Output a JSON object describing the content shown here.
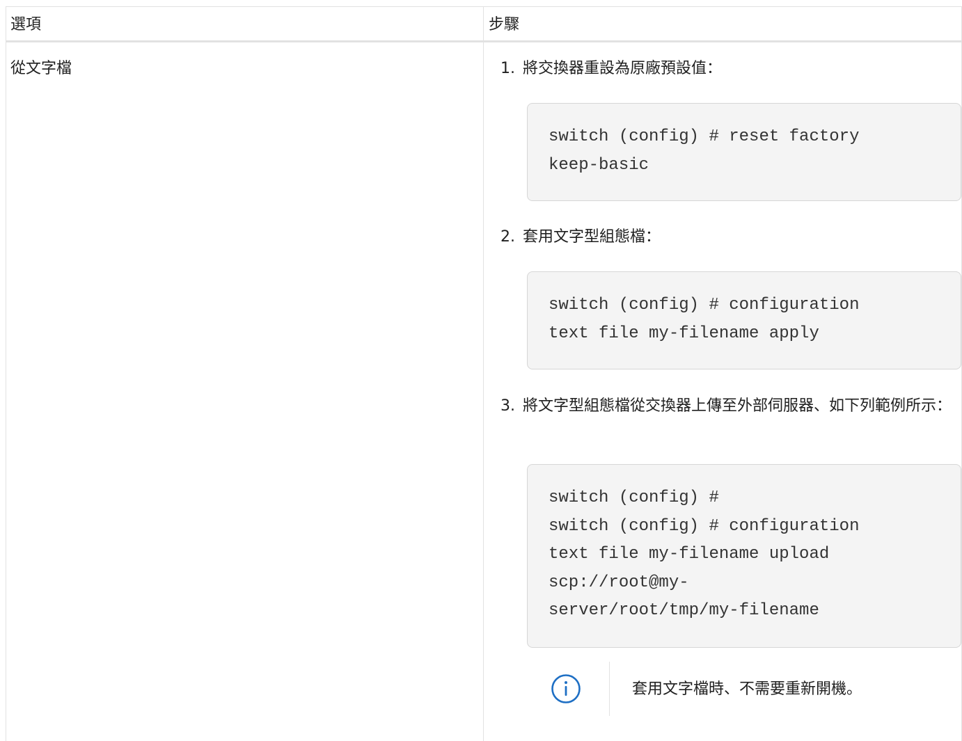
{
  "table": {
    "headers": {
      "option": "選項",
      "step": "步驟"
    },
    "row": {
      "option": "從文字檔",
      "steps": [
        {
          "number": "1.",
          "text": "將交換器重設為原廠預設值：",
          "code": "switch (config) # reset factory\nkeep-basic"
        },
        {
          "number": "2.",
          "text": "套用文字型組態檔：",
          "code": "switch (config) # configuration\ntext file my-filename apply"
        },
        {
          "number": "3.",
          "text": "將文字型組態檔從交換器上傳至外部伺服器、如下列範例所示：",
          "code": "switch (config) #\nswitch (config) # configuration\ntext file my-filename upload\nscp://root@my-\nserver/root/tmp/my-filename"
        }
      ],
      "note": {
        "icon": "info-icon",
        "text": "套用文字檔時、不需要重新開機。"
      }
    }
  },
  "colors": {
    "info_icon": "#1e6fc4",
    "code_background": "#f4f4f4",
    "border": "#e2e2e2"
  }
}
